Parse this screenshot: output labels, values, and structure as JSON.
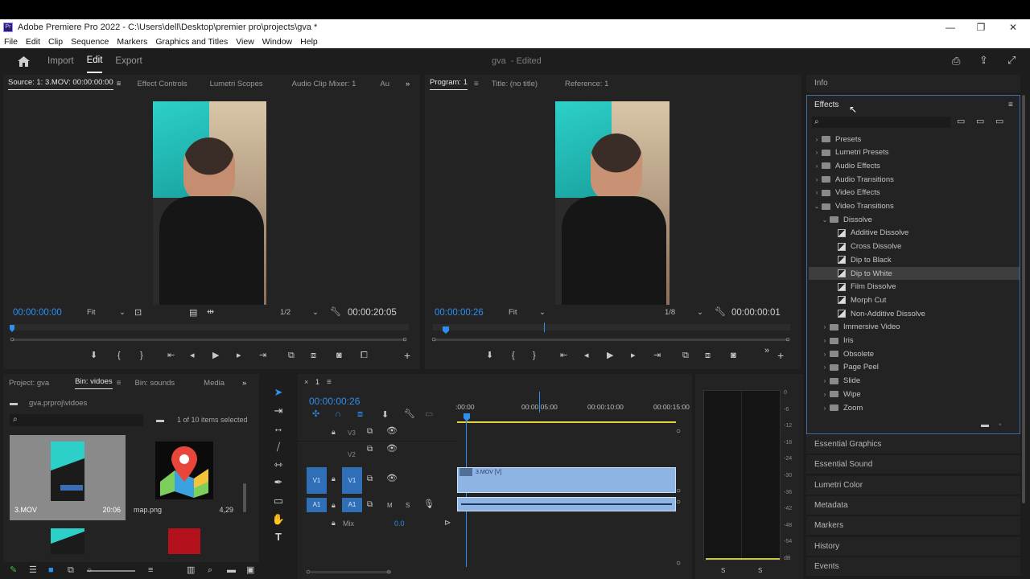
{
  "window": {
    "title": "Adobe Premiere Pro 2022 - C:\\Users\\dell\\Desktop\\premier pro\\projects\\gva *",
    "app_icon": "Pr",
    "minimize": "—",
    "maximize": "❐",
    "close": "✕"
  },
  "menu": [
    "File",
    "Edit",
    "Clip",
    "Sequence",
    "Markers",
    "Graphics and Titles",
    "View",
    "Window",
    "Help"
  ],
  "header": {
    "workspaces": [
      "Import",
      "Edit",
      "Export"
    ],
    "active_workspace": "Edit",
    "project_name": "gva",
    "project_status": "- Edited"
  },
  "source_monitor": {
    "tabs": [
      "Source: 1: 3.MOV: 00:00:00:00",
      "Effect Controls",
      "Lumetri Scopes",
      "Audio Clip Mixer: 1",
      "Au"
    ],
    "timecode": "00:00:00:00",
    "zoom": "Fit",
    "resolution": "1/2",
    "duration": "00:00:20:05"
  },
  "program_monitor": {
    "tabs": [
      "Program: 1",
      "Title: (no title)",
      "Reference: 1"
    ],
    "timecode": "00:00:00:26",
    "zoom": "Fit",
    "resolution": "1/8",
    "duration": "00:00:00:01"
  },
  "info_tab": "Info",
  "effects": {
    "title": "Effects",
    "search_placeholder": "",
    "items": [
      {
        "label": "Presets",
        "level": 0,
        "type": "folder",
        "expanded": false
      },
      {
        "label": "Lumetri Presets",
        "level": 0,
        "type": "folder",
        "expanded": false
      },
      {
        "label": "Audio Effects",
        "level": 0,
        "type": "folder",
        "expanded": false
      },
      {
        "label": "Audio Transitions",
        "level": 0,
        "type": "folder",
        "expanded": false
      },
      {
        "label": "Video Effects",
        "level": 0,
        "type": "folder",
        "expanded": false
      },
      {
        "label": "Video Transitions",
        "level": 0,
        "type": "folder",
        "expanded": true
      },
      {
        "label": "Dissolve",
        "level": 1,
        "type": "folder",
        "expanded": true
      },
      {
        "label": "Additive Dissolve",
        "level": 2,
        "type": "transition"
      },
      {
        "label": "Cross Dissolve",
        "level": 2,
        "type": "transition"
      },
      {
        "label": "Dip to Black",
        "level": 2,
        "type": "transition"
      },
      {
        "label": "Dip to White",
        "level": 2,
        "type": "transition",
        "selected": true
      },
      {
        "label": "Film Dissolve",
        "level": 2,
        "type": "transition"
      },
      {
        "label": "Morph Cut",
        "level": 2,
        "type": "transition"
      },
      {
        "label": "Non-Additive Dissolve",
        "level": 2,
        "type": "transition"
      },
      {
        "label": "Immersive Video",
        "level": 1,
        "type": "folder",
        "expanded": false
      },
      {
        "label": "Iris",
        "level": 1,
        "type": "folder",
        "expanded": false
      },
      {
        "label": "Obsolete",
        "level": 1,
        "type": "folder",
        "expanded": false
      },
      {
        "label": "Page Peel",
        "level": 1,
        "type": "folder",
        "expanded": false
      },
      {
        "label": "Slide",
        "level": 1,
        "type": "folder",
        "expanded": false
      },
      {
        "label": "Wipe",
        "level": 1,
        "type": "folder",
        "expanded": false
      },
      {
        "label": "Zoom",
        "level": 1,
        "type": "folder",
        "expanded": false
      }
    ]
  },
  "side_panels": [
    "Essential Graphics",
    "Essential Sound",
    "Lumetri Color",
    "Metadata",
    "Markers",
    "History",
    "Events"
  ],
  "project_panel": {
    "tabs": [
      "Project: gva",
      "Bin: vidoes",
      "Bin: sounds",
      "Media"
    ],
    "path": "gva.prproj\\vidoes",
    "selection_info": "1 of 10 items selected",
    "items": [
      {
        "name": "3.MOV",
        "duration": "20:06"
      },
      {
        "name": "map.png",
        "duration": "4,29"
      }
    ]
  },
  "timeline": {
    "sequence_name": "1",
    "timecode": "00:00:00:26",
    "ruler_labels": [
      ":00:00",
      "00:00:05:00",
      "00:00:10:00",
      "00:00:15:00"
    ],
    "tracks": {
      "v3": "V3",
      "v2": "V2",
      "v1": "V1",
      "a1": "A1",
      "source_v1": "V1",
      "source_a1": "A1",
      "mute": "M",
      "solo": "S",
      "mix": "Mix",
      "mix_value": "0.0"
    },
    "clip_label": "3.MOV [V]"
  },
  "audio_meter": {
    "scale": [
      "0",
      "-6",
      "-12",
      "-18",
      "-24",
      "-30",
      "-36",
      "-42",
      "-48",
      "-54",
      "dB"
    ],
    "solo_left": "S",
    "solo_right": "S"
  },
  "colors": {
    "accent_blue": "#2e8ff0",
    "clip_blue": "#8eb4e3",
    "track_target": "#2f6fb8",
    "selection_bg": "#3e3e3e"
  }
}
